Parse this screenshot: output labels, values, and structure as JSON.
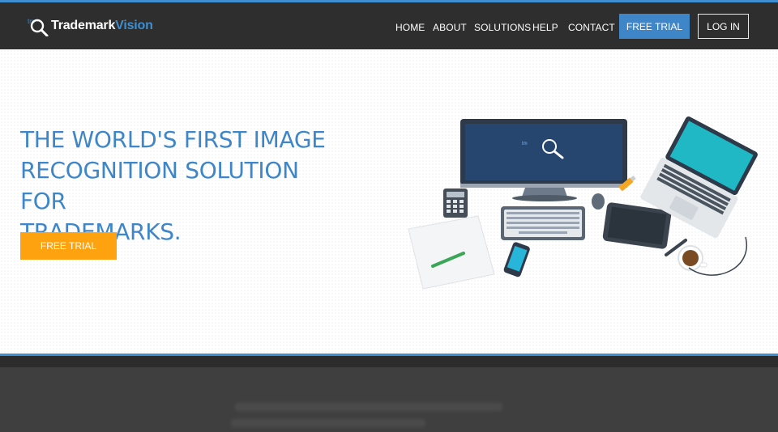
{
  "brand": {
    "name_main": "Trademark",
    "name_accent": "Vision",
    "mark_letters": "tm"
  },
  "nav": {
    "items": [
      {
        "label": "HOME"
      },
      {
        "label": "ABOUT"
      },
      {
        "label": "SOLUTIONS"
      },
      {
        "label": "HELP"
      },
      {
        "label": "CONTACT"
      }
    ],
    "free_trial_label": "FREE TRIAL",
    "login_label": "LOG IN"
  },
  "hero": {
    "title_line1": "THE WORLD'S FIRST IMAGE",
    "title_line2": "RECOGNITION SOLUTION FOR",
    "title_line3": "TRADEMARKS.",
    "cta_label": "FREE TRIAL"
  },
  "carousel": {
    "slide_count": 3,
    "active_index": 0
  },
  "colors": {
    "accent_blue": "#3e86c8",
    "cta_orange": "#ffa20f",
    "navbar_bg": "#2e2e2e"
  }
}
